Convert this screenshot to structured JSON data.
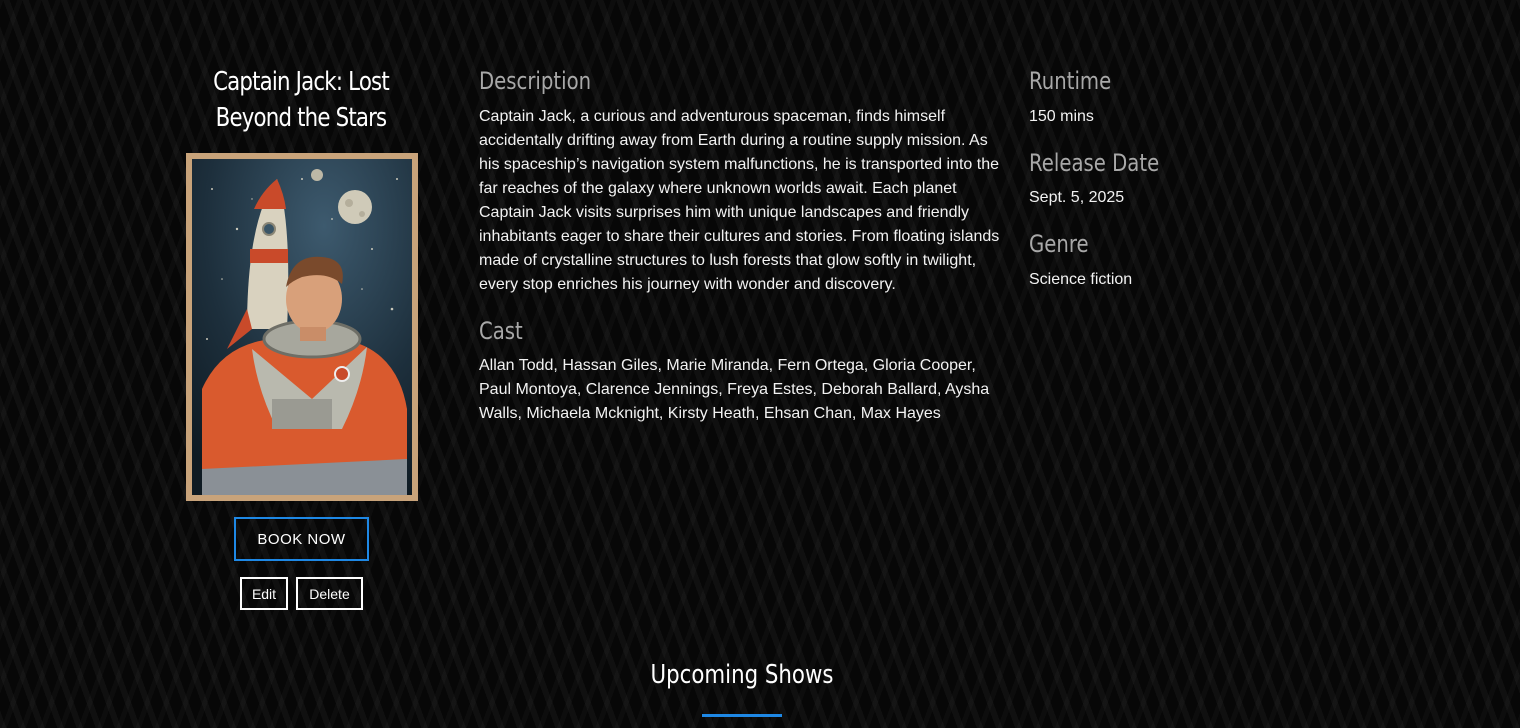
{
  "movie": {
    "title": "Captain Jack: Lost Beyond the Stars",
    "poster_icon": "astronaut-poster"
  },
  "actions": {
    "book_label": "BOOK NOW",
    "edit_label": "Edit",
    "delete_label": "Delete"
  },
  "description": {
    "heading": "Description",
    "text": "Captain Jack, a curious and adventurous spaceman, finds himself accidentally drifting away from Earth during a routine supply mission. As his spaceship’s navigation system malfunctions, he is transported into the far reaches of the galaxy where unknown worlds await. Each planet Captain Jack visits surprises him with unique landscapes and friendly inhabitants eager to share their cultures and stories. From floating islands made of crystalline structures to lush forests that glow softly in twilight, every stop enriches his journey with wonder and discovery."
  },
  "cast": {
    "heading": "Cast",
    "text": "Allan Todd, Hassan Giles, Marie Miranda, Fern Ortega, Gloria Cooper, Paul Montoya, Clarence Jennings, Freya Estes, Deborah Ballard, Aysha Walls, Michaela Mcknight, Kirsty Heath, Ehsan Chan, Max Hayes"
  },
  "details": {
    "runtime_heading": "Runtime",
    "runtime": "150 mins",
    "release_heading": "Release Date",
    "release_date": "Sept. 5, 2025",
    "genre_heading": "Genre",
    "genre": "Science fiction"
  },
  "upcoming": {
    "heading": "Upcoming Shows"
  },
  "colors": {
    "accent": "#1e88e5",
    "background": "#070707",
    "heading_gray": "#a8a8a8"
  }
}
